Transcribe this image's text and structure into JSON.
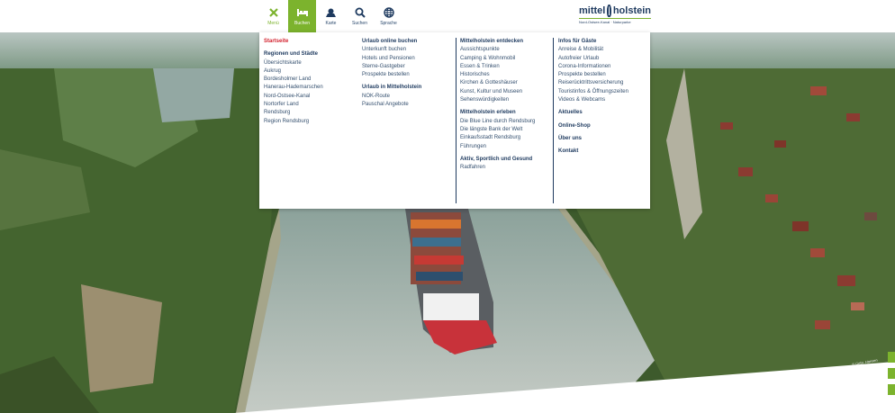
{
  "nav": {
    "items": [
      {
        "label": "Menü",
        "icon": "close-icon"
      },
      {
        "label": "Buchen",
        "icon": "bed-icon"
      },
      {
        "label": "Karte",
        "icon": "map-icon"
      },
      {
        "label": "Suchen",
        "icon": "search-icon"
      },
      {
        "label": "Sprache",
        "icon": "globe-icon"
      }
    ]
  },
  "logo": {
    "word1": "mittel",
    "word2": "holstein",
    "tagline": "Nord-Ostsee-Kanal · Naturparke"
  },
  "colors": {
    "accent": "#7cb32d",
    "brand": "#1e3a5f",
    "highlight": "#d3232f"
  },
  "menu": {
    "col1": {
      "start": "Startseite",
      "heading": "Regionen und Städte",
      "items": [
        "Übersichtskarte",
        "Aukrug",
        "Bordesholmer Land",
        "Hanerau-Hademarschen",
        "Nord-Ostsee-Kanal",
        "Nortorfer Land",
        "Rendsburg",
        "Region Rendsburg"
      ]
    },
    "col2": {
      "heading1": "Urlaub online buchen",
      "items1": [
        "Unterkunft buchen",
        "Hotels und Pensionen",
        "Sterne-Gastgeber",
        "Prospekte bestellen"
      ],
      "heading2": "Urlaub in Mittelholstein",
      "items2": [
        "NOK-Route",
        "Pauschal Angebote"
      ]
    },
    "col3": {
      "heading1": "Mittelholstein entdecken",
      "items1": [
        "Aussichtspunkte",
        "Camping & Wohnmobil",
        "Essen & Trinken",
        "Historisches",
        "Kirchen & Gotteshäuser",
        "Kunst, Kultur und Museen",
        "Sehenswürdigkeiten"
      ],
      "heading2": "Mittelholstein erleben",
      "items2": [
        "Die Blue Line durch Rendsburg",
        "Die längste Bank der Welt",
        "Einkaufsstadt Rendsburg",
        "Führungen"
      ],
      "heading3": "Aktiv, Sportlich und Gesund",
      "items3": [
        "Radfahren"
      ]
    },
    "col4": {
      "heading1": "Infos für Gäste",
      "items1": [
        "Anreise & Mobilität",
        "Autofreier Urlaub",
        "Corona-Informationen",
        "Prospekte bestellen",
        "Reiserücktrittsversicherung",
        "Touristinfos & Öffnungszeiten",
        "Videos & Webcams"
      ],
      "links": [
        "Aktuelles",
        "Online-Shop",
        "Über uns",
        "Kontakt"
      ]
    }
  },
  "credit": "© Gebr. Hansen"
}
